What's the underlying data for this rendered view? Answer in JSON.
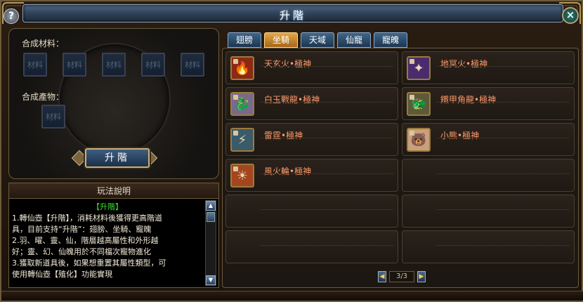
{
  "window": {
    "title": "升階"
  },
  "controls": {
    "help": "?",
    "close": "×"
  },
  "left": {
    "materials_label": "合成材料：",
    "product_label": "合成產物：",
    "material_slots": [
      "材料",
      "材料",
      "材料",
      "材料",
      "材料"
    ],
    "product_slot": "材料",
    "upgrade_button": "升階"
  },
  "help": {
    "header": "玩法說明",
    "subtitle": "【升階】",
    "lines": [
      "1.轉仙壺【升階】，消耗材料後獲得更高階道",
      "具，目前支持“升階”：翅膀、坐騎、寵魄",
      " 2.羽、曜、靈、仙，階層越高屬性和外形越",
      "好；靈、幻、仙魄用於不同檔次寵物進化",
      "3.獲取新道具後，如果想重置其屬性類型，可",
      "使用轉仙壺【殖化】功能實現"
    ]
  },
  "tabs": [
    {
      "label": "翅膀",
      "active": false
    },
    {
      "label": "坐騎",
      "active": true
    },
    {
      "label": "天域",
      "active": false
    },
    {
      "label": "仙寵",
      "active": false
    },
    {
      "label": "寵魄",
      "active": false
    }
  ],
  "items": [
    {
      "name": "天玄火•極神",
      "icon": "fire-mount-icon",
      "color": "#8b2a12",
      "glyph": "🔥"
    },
    {
      "name": "地冥火•極神",
      "icon": "dark-fire-mount-icon",
      "color": "#4a2c6e",
      "glyph": "✦"
    },
    {
      "name": "白玉戰龍•極神",
      "icon": "dragon-mount-icon",
      "color": "#7a6a8a",
      "glyph": "🐉"
    },
    {
      "name": "鐵甲角龍•極神",
      "icon": "horned-dragon-icon",
      "color": "#5b5a3a",
      "glyph": "🐲"
    },
    {
      "name": "雷霆•極神",
      "icon": "thunder-mount-icon",
      "color": "#3b5a6a",
      "glyph": "⚡"
    },
    {
      "name": "小熊•極神",
      "icon": "bear-mount-icon",
      "color": "#c9a07a",
      "glyph": "🐻"
    },
    {
      "name": "風火輪•極神",
      "icon": "fire-wheel-icon",
      "color": "#a3461e",
      "glyph": "☀"
    }
  ],
  "pager": {
    "text": "3/3",
    "prev": "◀",
    "next": "▶"
  }
}
